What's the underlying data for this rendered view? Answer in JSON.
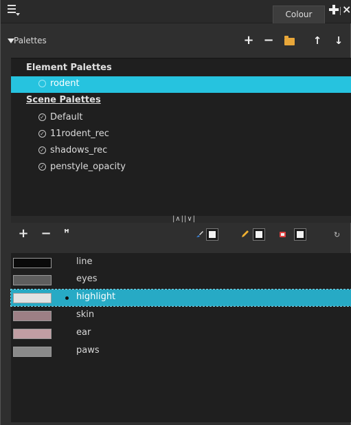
{
  "window": {
    "tab_label": "Colour"
  },
  "palettes_panel": {
    "label": "Palettes",
    "buttons": {
      "add": "+",
      "remove": "−",
      "move_up": "↑",
      "move_down": "↓"
    },
    "element_section": "Element Palettes",
    "scene_section": "Scene Palettes",
    "element_palettes": [
      {
        "name": "rodent",
        "selected": true
      }
    ],
    "scene_palettes": [
      {
        "name": "Default"
      },
      {
        "name": "11rodent_rec"
      },
      {
        "name": "shadows_rec"
      },
      {
        "name": "penstyle_opacity"
      }
    ]
  },
  "splitter": {
    "glyph": "|∧||∨|"
  },
  "colour_toolbar": {
    "add": "+",
    "remove": "−",
    "rename": "ꟸ"
  },
  "colours": [
    {
      "name": "line",
      "hex": "#0a0a0a",
      "selected": false,
      "current": false
    },
    {
      "name": "eyes",
      "hex": "#5e5e5e",
      "selected": false,
      "current": false
    },
    {
      "name": "highlight",
      "hex": "#e2e2e2",
      "selected": true,
      "current": true
    },
    {
      "name": "skin",
      "hex": "#9d7f85",
      "selected": false,
      "current": false
    },
    {
      "name": "ear",
      "hex": "#c19ea3",
      "selected": false,
      "current": false
    },
    {
      "name": "paws",
      "hex": "#8a8a8a",
      "selected": false,
      "current": false
    }
  ],
  "accent_color": "#26c3df"
}
